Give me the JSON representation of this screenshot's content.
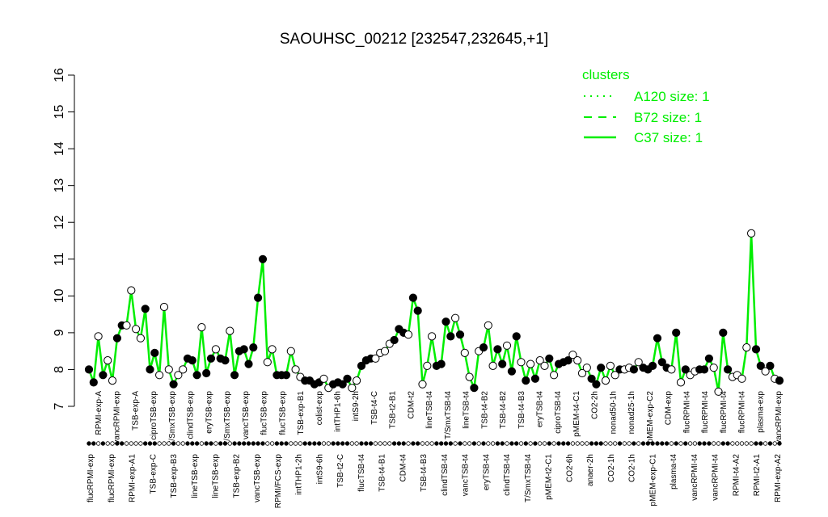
{
  "chart_data": {
    "type": "line",
    "title": "SAOUHSC_00212 [232547,232645,+1]",
    "xlabel": "",
    "ylabel": "",
    "ylim": [
      7,
      16
    ],
    "y_ticks": [
      7,
      8,
      9,
      10,
      11,
      12,
      13,
      14,
      15,
      16
    ],
    "line_color": "#00ee00",
    "legend": {
      "title": "clusters",
      "position": "top-right",
      "entries": [
        {
          "label": "A120 size: 1",
          "style": "dotted"
        },
        {
          "label": "B72 size: 1",
          "style": "dashed"
        },
        {
          "label": "C37 size: 1",
          "style": "solid"
        }
      ]
    },
    "series": [
      {
        "name": "C37",
        "values": [
          8.0,
          7.65,
          8.9,
          7.85,
          8.25,
          7.7,
          8.85,
          9.2,
          9.2,
          10.15,
          9.1,
          8.85,
          9.65,
          8.0,
          8.45,
          7.85,
          9.7,
          8.0,
          7.6,
          7.85,
          8.0,
          8.3,
          8.25,
          7.85,
          9.15,
          7.9,
          8.3,
          8.55,
          8.3,
          8.25,
          9.05,
          7.85,
          8.5,
          8.55,
          8.15,
          8.6,
          9.95,
          11.0,
          8.2,
          8.55,
          7.85,
          7.85,
          7.85,
          8.5,
          8.0,
          7.8,
          7.7,
          7.7,
          7.6,
          7.65,
          7.75,
          7.5,
          7.6,
          7.65,
          7.6,
          7.75,
          7.5,
          7.7,
          8.1,
          8.25,
          8.3,
          8.3,
          8.45,
          8.5,
          8.7,
          8.8,
          9.1,
          9.0,
          8.95,
          9.95,
          9.6,
          7.6,
          8.1,
          8.9,
          8.1,
          8.15,
          9.3,
          8.9,
          9.4,
          8.95,
          8.45,
          7.8,
          7.5,
          8.5,
          8.6,
          9.2,
          8.1,
          8.55,
          8.15,
          8.65,
          7.95,
          8.9,
          8.2,
          7.7,
          8.15,
          7.75,
          8.25,
          8.1,
          8.3,
          7.85,
          8.15,
          8.2,
          8.25,
          8.4,
          8.25,
          7.9,
          8.05,
          7.75,
          7.6,
          8.05,
          7.7,
          8.1,
          7.85,
          8.0,
          8.0,
          8.05,
          8.0,
          8.2,
          8.05,
          8.0,
          8.1,
          8.85,
          8.2,
          8.05,
          8.0,
          9.0,
          7.65,
          8.0,
          7.85,
          7.95,
          8.0,
          8.0,
          8.3,
          8.05,
          7.4,
          9.0,
          8.0,
          7.8,
          7.85,
          7.75,
          8.6,
          11.7,
          8.55,
          8.1,
          7.95,
          8.1,
          7.75,
          7.7
        ],
        "filled": [
          1,
          1,
          0,
          1,
          0,
          0,
          1,
          1,
          0,
          0,
          0,
          0,
          1,
          1,
          1,
          0,
          0,
          0,
          1,
          0,
          0,
          1,
          1,
          1,
          0,
          1,
          1,
          0,
          1,
          1,
          0,
          1,
          1,
          1,
          1,
          1,
          1,
          1,
          0,
          0,
          1,
          1,
          1,
          0,
          0,
          0,
          1,
          1,
          1,
          1,
          0,
          0,
          1,
          1,
          1,
          1,
          0,
          0,
          1,
          1,
          1,
          0,
          0,
          0,
          0,
          1,
          1,
          1,
          0,
          1,
          1,
          0,
          0,
          0,
          1,
          1,
          1,
          1,
          0,
          1,
          0,
          0,
          1,
          0,
          1,
          0,
          0,
          1,
          1,
          0,
          1,
          1,
          0,
          1,
          0,
          1,
          0,
          0,
          1,
          0,
          1,
          1,
          1,
          0,
          0,
          0,
          0,
          1,
          1,
          1,
          0,
          0,
          0,
          1,
          0,
          0,
          1,
          0,
          1,
          1,
          1,
          1,
          1,
          1,
          0,
          1,
          0,
          1,
          0,
          0,
          1,
          1,
          1,
          0,
          0,
          1,
          1,
          0,
          0,
          0,
          0,
          0,
          1,
          1,
          0,
          1,
          0,
          1,
          0
        ]
      }
    ],
    "x_tick_labels": [
      "flucRPMI-exp",
      "flucRPMI-exp",
      "RPMI-exp-A1",
      "TSB-exp-C",
      "TSB-exp-B3",
      "lineTSB-exp",
      "lineTSB-exp",
      "TSB-exp-B2",
      "vancTSB-exp",
      "RPMI/FCS-exp",
      "intTHP1-2h",
      "intS9-6h",
      "TSB-t2-C",
      "flucTSB-t4",
      "TSB-t4-B1",
      "CDM-t4",
      "TSB-t4-B3",
      "clindTSB-t4",
      "vancTSB-t4",
      "eryTSB-t4",
      "clindTSB-t4",
      "T/SmxTSB-t4",
      "pMEM-t2-C1",
      "CO2-6h",
      "anaer-2h",
      "CO2-1h",
      "CO2-1h",
      "pMEM-exp-C1",
      "plasma-t4",
      "vancRPMI-t4",
      "vancRPMI-t4",
      "RPMI-t4-A2",
      "RPMI-t2-A1",
      "RPMI-exp-A2"
    ],
    "top_point_labels": [
      "RPMI-exp-A",
      "vancRPMI-exp",
      "TSB-exp-A",
      "ciproTSB-exp",
      "T/SmxTSB-exp",
      "clindTSB-exp",
      "eryTSB-exp",
      "T/SmxTSB-exp",
      "vancTSB-exp",
      "flucTSB-exp",
      "flucTSB-exp",
      "TSB-exp-B1",
      "colist-exp",
      "intTHP1-6h",
      "intS9-2h",
      "TSB-t4-C",
      "TSB-t2-B1",
      "CDM-t2",
      "lineTSB-t4",
      "T/SmxTSB-t4",
      "lineTSB-t4",
      "TSB-t4-B2",
      "TSB-t4-B2",
      "TSB-t4-B3",
      "eryTSB-t4",
      "ciproTSB-t4",
      "pMEM-t4-C1",
      "CO2-2h",
      "nonad50-1h",
      "nonad25-1h",
      "pMEM-exp-C2",
      "CDM-exp",
      "flucRPMI-t4",
      "flucRPMI-t4",
      "flucRPMI-t4",
      "flucRPMI-t4",
      "plasma-exp",
      "vancRPMI-exp"
    ]
  }
}
